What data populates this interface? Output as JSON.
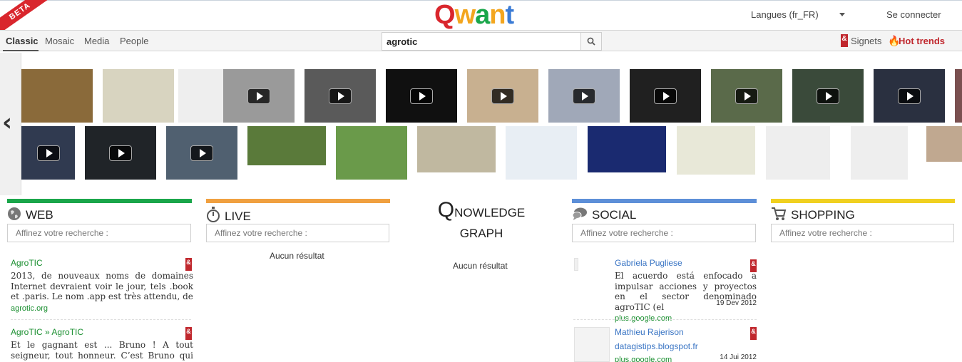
{
  "header": {
    "beta_label": "BETA",
    "logo_letters": [
      {
        "ch": "Q",
        "color": "#d9262d"
      },
      {
        "ch": "w",
        "color": "#f3a61f"
      },
      {
        "ch": "a",
        "color": "#1aa64a"
      },
      {
        "ch": "n",
        "color": "#f3a61f"
      },
      {
        "ch": "t",
        "color": "#3a7bd5"
      }
    ],
    "language": "Langues (fr_FR)",
    "login": "Se connecter"
  },
  "nav": {
    "tabs": [
      "Classic",
      "Mosaic",
      "Media",
      "People"
    ],
    "active_tab": "Classic",
    "search_value": "agrotic",
    "signets_icon": "&",
    "signets": "Signets",
    "hot_trends": "Hot trends"
  },
  "columns": {
    "web": {
      "title": "WEB",
      "color": "#1aa64a",
      "refine_placeholder": "Affinez votre recherche :",
      "results": [
        {
          "title": "AgroTIC",
          "text": "2013, de nouveaux noms de domaines Internet devraient voir le jour, tels .book et .paris. Le nom .app est très attendu, de",
          "url": "agrotic.org"
        },
        {
          "title": "AgroTIC » AgroTIC",
          "text": "Et le gagnant est ... Bruno ! A tout seigneur, tout honneur. C’est Bruno qui publie, sans"
        }
      ]
    },
    "live": {
      "title": "LIVE",
      "color": "#f0a040",
      "refine_placeholder": "Affinez votre recherche :",
      "no_result": "Aucun résultat"
    },
    "knowledge": {
      "title_big": "Q",
      "title_rest": "NOWLEDGE",
      "title_line2": "GRAPH",
      "no_result": "Aucun résultat"
    },
    "social": {
      "title": "SOCIAL",
      "color": "#5d8fd8",
      "refine_placeholder": "Affinez votre recherche :",
      "results": [
        {
          "title": "Gabriela Pugliese",
          "text": "El acuerdo está enfocado a impulsar acciones y proyectos en el sector denominado agroTIC (el",
          "url": "plus.google.com",
          "date": "19 Dev 2012"
        },
        {
          "title": "Mathieu Rajerison",
          "subtitle": "datagistips.blogspot.fr",
          "url": "plus.google.com",
          "date": "14 Jui 2012"
        }
      ]
    },
    "shopping": {
      "title": "SHOPPING",
      "color": "#f0d020",
      "refine_placeholder": "Affinez votre recherche :"
    }
  },
  "strip": {
    "row1": [
      {
        "bg": "#8a6a3a",
        "video": false
      },
      {
        "bg": "#d8d4c0",
        "video": false
      },
      {
        "bg": "#eeeeee",
        "video": false
      },
      {
        "bg": "#9a9a9a",
        "video": true
      },
      {
        "bg": "#5a5a5a",
        "video": true
      },
      {
        "bg": "#101010",
        "video": true
      },
      {
        "bg": "#c8b090",
        "video": true
      },
      {
        "bg": "#a0a8b8",
        "video": true
      },
      {
        "bg": "#202020",
        "video": true
      },
      {
        "bg": "#5a6a4a",
        "video": true
      },
      {
        "bg": "#3a4a3a",
        "video": true
      },
      {
        "bg": "#2a3040",
        "video": true
      },
      {
        "bg": "#7a5050",
        "video": false
      }
    ],
    "row2": [
      {
        "bg": "#303a50",
        "video": true
      },
      {
        "bg": "#202428",
        "video": true
      },
      {
        "bg": "#506070",
        "video": true
      },
      {
        "bg": "#5a7a3a",
        "video": false
      },
      {
        "bg": "#6a9a4a",
        "video": false
      },
      {
        "bg": "#c0b8a0",
        "video": false
      },
      {
        "bg": "#e8eef4",
        "video": false
      },
      {
        "bg": "#1a2a70",
        "video": false
      },
      {
        "bg": "#e8e8d8",
        "video": false
      },
      {
        "bg": "#eeeeee",
        "video": false
      },
      {
        "bg": "#eeeeee",
        "video": false
      },
      {
        "bg": "#c0a890",
        "video": false
      }
    ]
  }
}
